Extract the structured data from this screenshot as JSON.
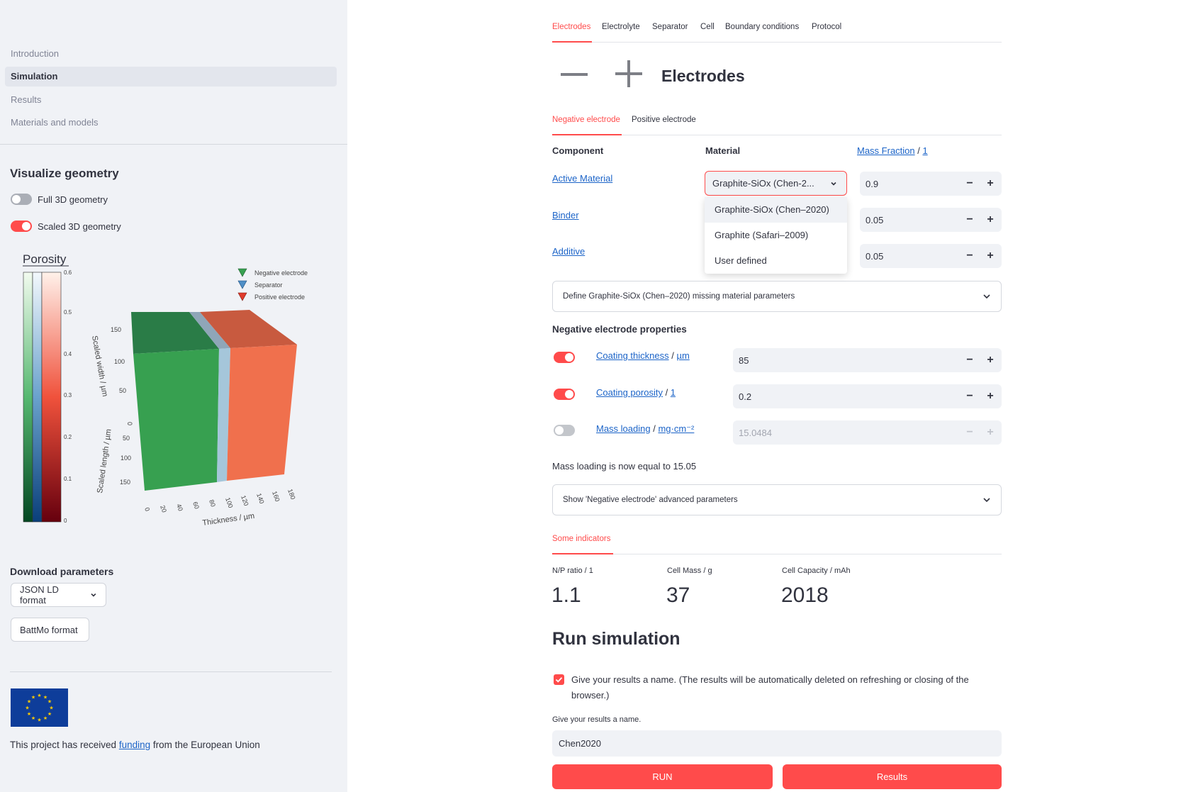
{
  "sidebar": {
    "nav": [
      "Introduction",
      "Simulation",
      "Results",
      "Materials and models"
    ],
    "visualize_title": "Visualize geometry",
    "toggles": [
      {
        "label": "Full 3D geometry",
        "on": false
      },
      {
        "label": "Scaled 3D geometry",
        "on": true
      }
    ],
    "plot": {
      "colorbar_title": "Porosity",
      "colorbar_ticks": [
        "0.6",
        "0.5",
        "0.4",
        "0.3",
        "0.2",
        "0.1",
        "0"
      ],
      "legend": [
        "Negative electrode",
        "Separator",
        "Positive electrode"
      ],
      "width_ticks": [
        "150",
        "100",
        "50",
        "0"
      ],
      "length_ticks": [
        "50",
        "100",
        "150"
      ],
      "thickness_ticks": [
        "0",
        "20",
        "40",
        "60",
        "80",
        "100",
        "120",
        "140",
        "160",
        "180"
      ],
      "width_label": "Scaled width  /  µm",
      "length_label": "Scaled length  /  µm",
      "thickness_label": "Thickness  /  µm"
    },
    "download_title": "Download parameters",
    "json_btn": "JSON LD format",
    "battmo_btn": "BattMo format",
    "funding_pre": "This project has received ",
    "funding_link": "funding",
    "funding_post": " from the European Union"
  },
  "tabs": [
    "Electrodes",
    "Electrolyte",
    "Separator",
    "Cell",
    "Boundary conditions",
    "Protocol"
  ],
  "title": "Electrodes",
  "electrode_tabs": [
    "Negative electrode",
    "Positive electrode"
  ],
  "table": {
    "component_head": "Component",
    "material_head": "Material",
    "mass_fraction": "Mass Fraction",
    "mass_fraction_unit": "1",
    "rows": [
      {
        "component": "Active Material",
        "value": "0.9"
      },
      {
        "component": "Binder",
        "value": "0.05"
      },
      {
        "component": "Additive",
        "value": "0.05"
      }
    ],
    "selected_material": "Graphite-SiOx (Chen-2...",
    "options": [
      "Graphite-SiOx (Chen–2020)",
      "Graphite (Safari–2009)",
      "User defined"
    ]
  },
  "missing_params": "Define Graphite-SiOx (Chen–2020) missing material parameters",
  "props_title": "Negative electrode properties",
  "props": [
    {
      "label": "Coating thickness",
      "unit": "µm",
      "value": "85",
      "on": true
    },
    {
      "label": "Coating porosity",
      "unit": "1",
      "value": "0.2",
      "on": true
    },
    {
      "label": "Mass loading",
      "unit": "mg·cm⁻²",
      "value": "15.0484",
      "on": false
    }
  ],
  "mass_loading_note": "Mass loading is now equal to 15.05",
  "advanced": "Show 'Negative electrode' advanced parameters",
  "indicators_tab": "Some indicators",
  "metrics": [
    {
      "label": "N/P ratio / 1",
      "value": "1.1"
    },
    {
      "label": "Cell Mass / g",
      "value": "37"
    },
    {
      "label": "Cell Capacity / mAh",
      "value": "2018"
    }
  ],
  "run_title": "Run simulation",
  "checkbox_text": "Give your results a name. (The results will be automatically deleted on refreshing or closing of the browser.)",
  "name_label": "Give your results a name.",
  "name_value": "Chen2020",
  "run_btn": "RUN",
  "results_btn": "Results",
  "colors": {
    "accent": "#ff4b4b",
    "negative": "#37a050",
    "separator": "#9fc3dc",
    "positive": "#f0704d"
  }
}
